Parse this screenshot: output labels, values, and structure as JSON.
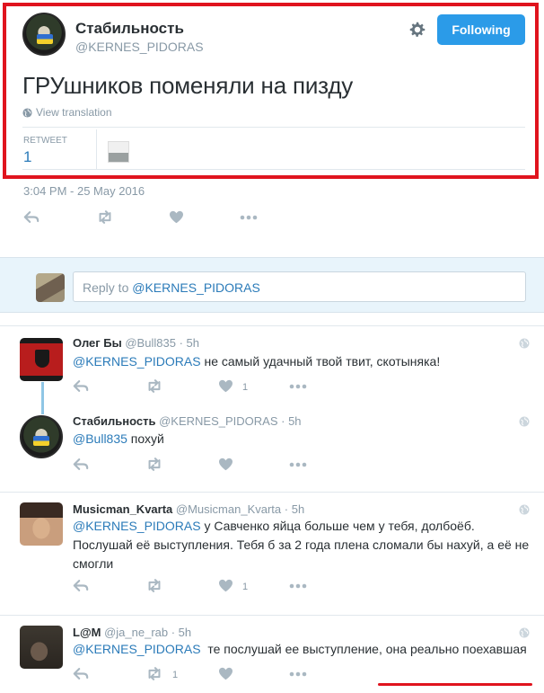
{
  "main_tweet": {
    "display_name": "Стабильность",
    "handle": "@KERNES_PIDORAS",
    "follow_label": "Following",
    "text": "ГРУшников поменяли на пизду",
    "translate_label": "View translation",
    "retweet_label": "RETWEET",
    "retweet_count": "1",
    "timestamp": "3:04 PM - 25 May 2016"
  },
  "reply_box": {
    "prefix": "Reply to ",
    "mention": "@KERNES_PIDORAS"
  },
  "replies": [
    {
      "name": "Олег Бы",
      "handle": "@Bull835",
      "time": "· 5h",
      "mention": "@KERNES_PIDORAS",
      "text": " не самый удачный твой твит, скотыняка!",
      "like_count": "1"
    },
    {
      "name": "Стабильность",
      "handle": "@KERNES_PIDORAS",
      "time": "· 5h",
      "mention": "@Bull835",
      "text": " похуй",
      "like_count": ""
    },
    {
      "name": "Musicman_Kvarta",
      "handle": "@Musicman_Kvarta",
      "time": "· 5h",
      "mention": "@KERNES_PIDORAS",
      "text": " у Савченко яйца больше чем у тебя, долбоёб. Послушай её выступления. Тебя б за 2 года плена сломали бы нахуй, а её не смогли",
      "like_count": "1"
    },
    {
      "name": "L@M",
      "handle": "@ja_ne_rab",
      "time": "· 5h",
      "mention": "@KERNES_PIDORAS",
      "text": "  те послушай ее выступление, она реально поехавшая",
      "retweet_count": "1"
    }
  ],
  "colors": {
    "accent": "#2b9be8",
    "link": "#2b7bb9",
    "highlight": "#e0141e"
  }
}
